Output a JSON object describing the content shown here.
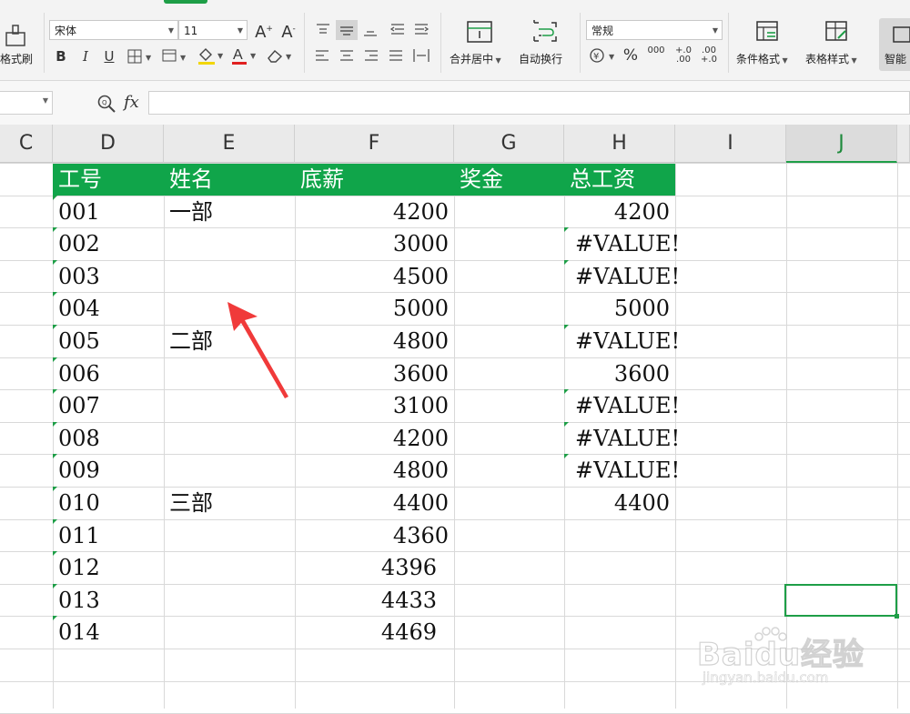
{
  "ribbon": {
    "format_painter_label": "格式刷",
    "font_name": "宋体",
    "font_size": "11",
    "merge_center_label": "合并居中",
    "wrap_text_label": "自动换行",
    "number_format": "常规",
    "conditional_format_label": "条件格式",
    "table_style_label": "表格样式",
    "smart_label": "智能",
    "bold": "B",
    "italic": "I",
    "underline": "U",
    "percent": "%",
    "thousands": "000",
    "inc_decimal": "+.0\n.00",
    "dec_decimal": ".00\n+.0"
  },
  "formula_bar": {
    "fx_label": "fx",
    "value": ""
  },
  "columns": [
    "C",
    "D",
    "E",
    "F",
    "G",
    "H",
    "I",
    "J"
  ],
  "selected_column": "J",
  "table": {
    "headers": [
      "工号",
      "姓名",
      "底薪",
      "奖金",
      "总工资"
    ],
    "header_color": "#10a54a",
    "rows": [
      {
        "id": "001",
        "name": "一部",
        "base": "4200",
        "bonus": "",
        "total": "4200"
      },
      {
        "id": "002",
        "name": "",
        "base": "3000",
        "bonus": "",
        "total": "#VALUE!"
      },
      {
        "id": "003",
        "name": "",
        "base": "4500",
        "bonus": "",
        "total": "#VALUE!"
      },
      {
        "id": "004",
        "name": "",
        "base": "5000",
        "bonus": "",
        "total": "5000"
      },
      {
        "id": "005",
        "name": "二部",
        "base": "4800",
        "bonus": "",
        "total": "#VALUE!"
      },
      {
        "id": "006",
        "name": "",
        "base": "3600",
        "bonus": "",
        "total": "3600"
      },
      {
        "id": "007",
        "name": "",
        "base": "3100",
        "bonus": "",
        "total": "#VALUE!"
      },
      {
        "id": "008",
        "name": "",
        "base": "4200",
        "bonus": "",
        "total": "#VALUE!"
      },
      {
        "id": "009",
        "name": "",
        "base": "4800",
        "bonus": "",
        "total": "#VALUE!"
      },
      {
        "id": "010",
        "name": "三部",
        "base": "4400",
        "bonus": "",
        "total": "4400"
      },
      {
        "id": "011",
        "name": "",
        "base": "4360",
        "bonus": "",
        "total": ""
      },
      {
        "id": "012",
        "name": "",
        "base": "4396",
        "bonus": "",
        "total": ""
      },
      {
        "id": "013",
        "name": "",
        "base": "4433",
        "bonus": "",
        "total": ""
      },
      {
        "id": "014",
        "name": "",
        "base": "4469",
        "bonus": "",
        "total": ""
      }
    ]
  },
  "watermark": {
    "brand": "Baidu经验",
    "url": "jingyan.baidu.com"
  },
  "colors": {
    "accent": "#1e9e47",
    "arrow": "#f03a3a"
  }
}
